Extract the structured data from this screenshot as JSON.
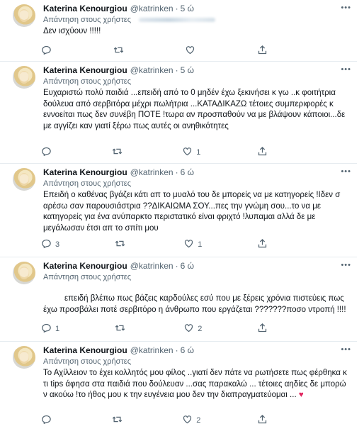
{
  "tweets": [
    {
      "name": "Katerina Kenourgiou",
      "handle": "@katrinken",
      "time": "5 ώ",
      "reply_prefix": "Απάντηση στους χρήστες",
      "text": "Δεν ισχύουν !!!!!",
      "indent": "",
      "counts": {
        "reply": "",
        "retweet": "",
        "like": ""
      }
    },
    {
      "name": "Katerina Kenourgiou",
      "handle": "@katrinken",
      "time": "5 ώ",
      "reply_prefix": "Απάντηση στους χρήστες",
      "text": "Ευχαριστώ πολύ παιδιά ...επειδή από το 0 μηδέν έχω ξεκινήσει κ γω ..κ φοιτήτρια δούλευα από σερβιτόρα μέχρι πωλήτρια ...ΚΑΤΑΔΙΚΑΖΩ τέτοιες συμπεριφορές κ εννοείται πως δεν συνέβη ΠΟΤΕ !τωρα αν προσπαθούν να με βλάψουν κάποιοι...δε με αγγίζει καν γιατί ξέρω πως αυτές οι ανηθικότητες",
      "indent": "",
      "counts": {
        "reply": "",
        "retweet": "",
        "like": "1"
      }
    },
    {
      "name": "Katerina Kenourgiou",
      "handle": "@katrinken",
      "time": "6 ώ",
      "reply_prefix": "Απάντηση στους χρήστες",
      "text": "Επειδή ο καθένας βγάζει κάτι απ το μυαλό του δε μπορείς να με κατηγορείς !Ιδεν σ αρέσω σαν παρουσιάστρια ??ΔΙΚΑΙΩΜΑ ΣΟΥ...πες την γνώμη σου...το να με κατηγορείς για ένα ανύπαρκτο περιστατικό είναι φριχτό !λυπαμαι αλλά δε με μεγάλωσαν έτσι απ το σπίτι μου",
      "indent": "",
      "counts": {
        "reply": "3",
        "retweet": "",
        "like": "1"
      }
    },
    {
      "name": "Katerina Kenourgiou",
      "handle": "@katrinken",
      "time": "6 ώ",
      "reply_prefix": "Απάντηση στους χρήστες",
      "text": "επειδή βλέπω πως βάζεις καρδούλες εσύ που με ξέρεις χρόνια πιστεύεις πως έχω προσβάλει ποτέ σερβιτόρο η άνθρωπο που εργάζεται ???????ποσο ντροπή !!!!",
      "indent": "      ",
      "counts": {
        "reply": "1",
        "retweet": "",
        "like": "2"
      }
    },
    {
      "name": "Katerina Kenourgiou",
      "handle": "@katrinken",
      "time": "6 ώ",
      "reply_prefix": "Απάντηση στους χρήστες",
      "text": "Το Αχίλλειον το έχει κολλητός μου φίλος ..γιατί δεν πάτε να ρωτήσετε πως φέρθηκα κ τι tips άφησα στα παιδιά που δούλευαν ...σας παρακαλώ ... τέτοιες αηδίες δε μπορώ ν ακούω !το ήθος μου κ την ευγένεια μου δεν την διαπραγματεύομαι ...",
      "indent": "",
      "counts": {
        "reply": "",
        "retweet": "",
        "like": "2"
      }
    }
  ],
  "icons": {
    "reply": "reply-icon",
    "retweet": "retweet-icon",
    "like": "like-icon",
    "share": "share-icon",
    "more": "more-icon",
    "heart_emoji": "red-heart-icon"
  },
  "colors": {
    "text": "#0f1419",
    "secondary": "#536471",
    "link": "#1d9bf0",
    "divider": "#e6ecf0",
    "heart": "#e0245e"
  }
}
